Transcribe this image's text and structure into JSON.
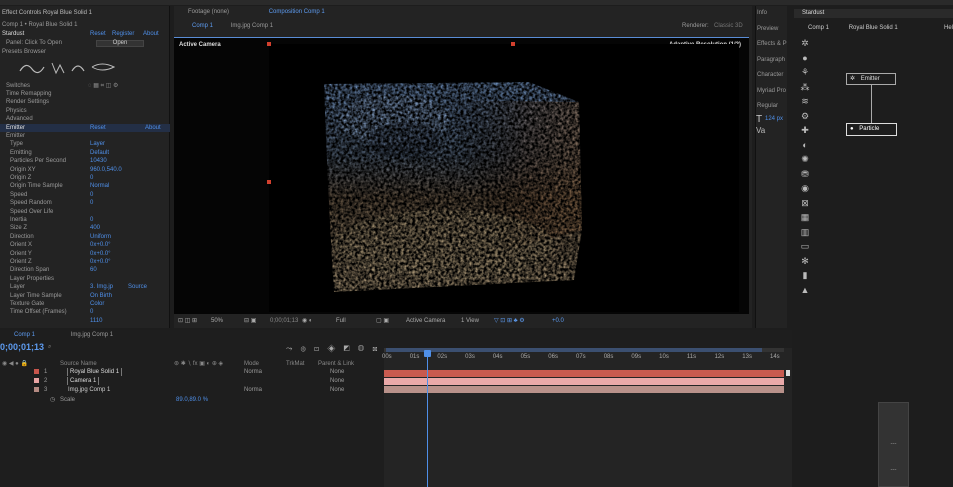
{
  "top_tabs": {
    "effect_controls": "Effect Controls Royal Blue Solid 1",
    "footage": "Footage (none)",
    "composition": "Composition Comp 1"
  },
  "effect_panel": {
    "header": "Comp 1 • Royal Blue Solid 1",
    "stardust": "Stardust",
    "reset": "Reset",
    "register": "Register",
    "about": "About",
    "panel_click": "Panel: Click To Open",
    "open": "Open",
    "presets_browser": "Presets Browser",
    "switches": "Switches",
    "rows": [
      {
        "label": "Time Remapping",
        "value": ""
      },
      {
        "label": "Render Settings",
        "value": ""
      },
      {
        "label": "Physics",
        "value": ""
      },
      {
        "label": "Advanced",
        "value": ""
      },
      {
        "label": "Emitter",
        "value": "Reset",
        "value2": "About"
      },
      {
        "label": "Emitter",
        "value": ""
      },
      {
        "label": "Type",
        "value": "Layer"
      },
      {
        "label": "Emitting",
        "value": "Default"
      },
      {
        "label": "Particles Per Second",
        "value": "10430"
      },
      {
        "label": "Origin XY",
        "value": "960.0,540.0"
      },
      {
        "label": "Origin Z",
        "value": "0"
      },
      {
        "label": "Origin Time Sample",
        "value": "Normal"
      },
      {
        "label": "Speed",
        "value": "0"
      },
      {
        "label": "Speed Random",
        "value": "0"
      },
      {
        "label": "Speed Over Life",
        "value": ""
      },
      {
        "label": "Inertia",
        "value": "0"
      },
      {
        "label": "Size Z",
        "value": "400"
      },
      {
        "label": "Direction",
        "value": "Uniform"
      },
      {
        "label": "Orient X",
        "value": "0x+0.0°"
      },
      {
        "label": "Orient Y",
        "value": "0x+0.0°"
      },
      {
        "label": "Orient Z",
        "value": "0x+0.0°"
      },
      {
        "label": "Direction Span",
        "value": "60"
      },
      {
        "label": "Layer Properties",
        "value": ""
      },
      {
        "label": "Layer",
        "value": "3. Img.jp",
        "value2": "Source"
      },
      {
        "label": "Layer Time Sample",
        "value": "On Birth"
      },
      {
        "label": "Texture Gate",
        "value": "Color"
      },
      {
        "label": "Time Offset (Frames)",
        "value": "0"
      },
      {
        "label": "",
        "value": "1110"
      }
    ]
  },
  "composition": {
    "tab_comp": "Comp 1",
    "tab_img": "Img.jpg Comp 1",
    "active_camera": "Active Camera",
    "adaptive": "Adaptive Resolution (1/2)",
    "renderer": "Renderer:",
    "renderer_value": "Classic 3D",
    "bottom": {
      "zoom": "50%",
      "time": "0;00;01;13",
      "quality": "Full",
      "camera": "Active Camera",
      "view": "1 View",
      "exposure": "+0.0"
    }
  },
  "right_panel": {
    "items": [
      "Info",
      "Preview",
      "Effects & P",
      "Paragraph",
      "Character",
      "Myriad Pro",
      "Regular"
    ],
    "size_value": "124 px"
  },
  "stardust_panel": {
    "tab": "Stardust",
    "breadcrumb": "Comp 1",
    "layer": "Royal Blue Solid 1",
    "help": "Help",
    "nodes": {
      "emitter": "Emitter",
      "particle": "Particle"
    },
    "side_box": [
      "---",
      "---"
    ]
  },
  "timeline": {
    "tab_comp": "Comp 1",
    "tab_img": "Img.jpg Comp 1",
    "timecode": "0;00;01;13",
    "columns": {
      "source": "Source Name",
      "mode": "Mode",
      "trkmat": "TrkMat",
      "parent": "Parent & Link"
    },
    "layers": [
      {
        "num": "1",
        "name": "Royal Blue Solid 1",
        "mode": "Norma",
        "parent": "None",
        "color": "#c8554c"
      },
      {
        "num": "2",
        "name": "Camera 1",
        "mode": "",
        "parent": "None",
        "color": "#e8a3a3"
      },
      {
        "num": "3",
        "name": "Img.jpg Comp 1",
        "mode": "Norma",
        "parent": "None",
        "color": "#b48a82"
      }
    ],
    "scale_label": "Scale",
    "scale_value": "89.0,89.0 %",
    "ruler": [
      "00s",
      "01s",
      "02s",
      "03s",
      "04s",
      "05s",
      "06s",
      "07s",
      "08s",
      "09s",
      "10s",
      "11s",
      "12s",
      "13s",
      "14s"
    ]
  },
  "colors": {
    "accent": "#4f8fe8",
    "bg": "#1d1d1d",
    "panel": "#232323",
    "viewer": "#000000"
  }
}
